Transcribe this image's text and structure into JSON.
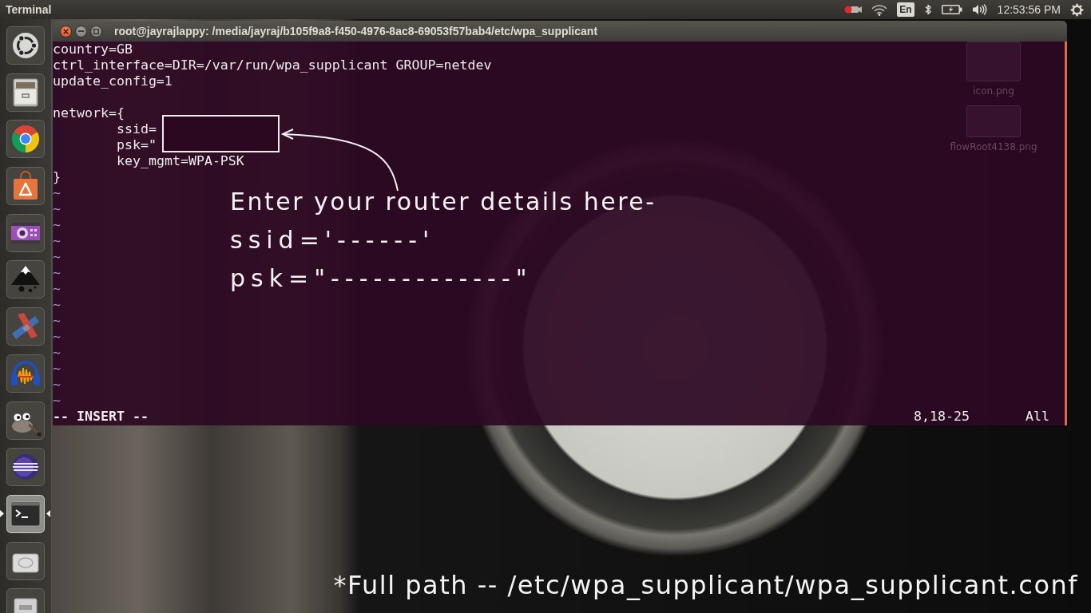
{
  "top_panel": {
    "app_title": "Terminal",
    "keyboard_layout": "En",
    "clock": "12:53:56 PM"
  },
  "launcher": {
    "items": [
      {
        "kind": "dash",
        "active": false
      },
      {
        "kind": "files",
        "active": false
      },
      {
        "kind": "browser",
        "active": false
      },
      {
        "kind": "store",
        "active": false
      },
      {
        "kind": "video",
        "active": false
      },
      {
        "kind": "vector",
        "active": false
      },
      {
        "kind": "strips",
        "active": false
      },
      {
        "kind": "audio",
        "active": false
      },
      {
        "kind": "paint",
        "active": false
      },
      {
        "kind": "ide",
        "active": false
      },
      {
        "kind": "terminal",
        "active": true
      },
      {
        "kind": "drive",
        "active": false
      },
      {
        "kind": "usb",
        "active": false
      }
    ]
  },
  "desktop_icons": [
    {
      "label": "icon.png"
    },
    {
      "label": "flowRoot4138.png"
    }
  ],
  "terminal": {
    "title": "root@jayrajlappy: /media/jayraj/b105f9a8-f450-4976-8ac8-69053f57bab4/etc/wpa_supplicant",
    "lines": [
      {
        "kind": "text",
        "text": "country=GB"
      },
      {
        "kind": "text",
        "text": "ctrl_interface=DIR=/var/run/wpa_supplicant GROUP=netdev"
      },
      {
        "kind": "text",
        "text": "update_config=1"
      },
      {
        "kind": "blank"
      },
      {
        "kind": "text",
        "text": "network={",
        "children": [
          {
            "kind": "text",
            "text": "ssid="
          },
          {
            "kind": "text",
            "text": "psk=\""
          },
          {
            "kind": "text",
            "text": "key_mgmt=WPA-PSK"
          }
        ]
      },
      {
        "kind": "text",
        "text": "}"
      },
      {
        "kind": "filler",
        "text": "~"
      },
      {
        "kind": "filler",
        "text": "~"
      },
      {
        "kind": "filler",
        "text": "~"
      },
      {
        "kind": "filler",
        "text": "~"
      },
      {
        "kind": "filler",
        "text": "~"
      },
      {
        "kind": "filler",
        "text": "~"
      },
      {
        "kind": "filler",
        "text": "~"
      },
      {
        "kind": "filler",
        "text": "~"
      },
      {
        "kind": "filler",
        "text": "~"
      },
      {
        "kind": "filler",
        "text": "~"
      },
      {
        "kind": "filler",
        "text": "~"
      },
      {
        "kind": "filler",
        "text": "~"
      },
      {
        "kind": "filler",
        "text": "~"
      },
      {
        "kind": "filler",
        "text": "~"
      }
    ],
    "status": {
      "mode": "-- INSERT --",
      "position": "8,18-25",
      "scroll": "All"
    }
  },
  "annotation": {
    "heading": "Enter your router details here-",
    "lines": [
      "ssid='------'",
      "psk=\"-------------\""
    ]
  },
  "caption": "*Full path -- /etc/wpa_supplicant/wpa_supplicant.conf"
}
